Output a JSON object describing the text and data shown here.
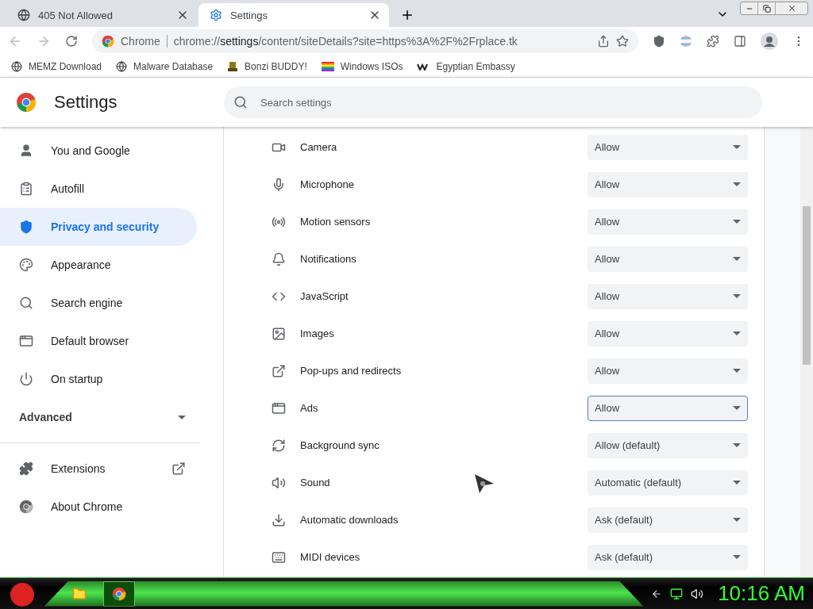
{
  "tabs": [
    {
      "title": "405 Not Allowed",
      "selected": false
    },
    {
      "title": "Settings",
      "selected": true
    }
  ],
  "toolbar": {
    "site_label": "Chrome",
    "url": "chrome://**settings**/content/siteDetails?site=https%3A%2F%2Frplace.tk"
  },
  "bookmarks": [
    {
      "label": "MEMZ Download"
    },
    {
      "label": "Malware Database"
    },
    {
      "label": "Bonzi BUDDY!"
    },
    {
      "label": "Windows ISOs"
    },
    {
      "label": "Egyptian Embassy"
    }
  ],
  "header": {
    "title": "Settings",
    "search_placeholder": "Search settings"
  },
  "sidebar": {
    "items": [
      {
        "label": "You and Google",
        "selected": false
      },
      {
        "label": "Autofill",
        "selected": false
      },
      {
        "label": "Privacy and security",
        "selected": true
      },
      {
        "label": "Appearance",
        "selected": false
      },
      {
        "label": "Search engine",
        "selected": false
      },
      {
        "label": "Default browser",
        "selected": false
      },
      {
        "label": "On startup",
        "selected": false
      }
    ],
    "advanced": {
      "label": "Advanced",
      "expanded": false
    },
    "links": [
      {
        "label": "Extensions"
      },
      {
        "label": "About Chrome"
      }
    ]
  },
  "permissions": [
    {
      "label": "Camera",
      "value": "Allow",
      "focused": false
    },
    {
      "label": "Microphone",
      "value": "Allow",
      "focused": false
    },
    {
      "label": "Motion sensors",
      "value": "Allow",
      "focused": false
    },
    {
      "label": "Notifications",
      "value": "Allow",
      "focused": false
    },
    {
      "label": "JavaScript",
      "value": "Allow",
      "focused": false
    },
    {
      "label": "Images",
      "value": "Allow",
      "focused": false
    },
    {
      "label": "Pop-ups and redirects",
      "value": "Allow",
      "focused": false
    },
    {
      "label": "Ads",
      "value": "Allow",
      "focused": true
    },
    {
      "label": "Background sync",
      "value": "Allow (default)",
      "focused": false
    },
    {
      "label": "Sound",
      "value": "Automatic (default)",
      "focused": false
    },
    {
      "label": "Automatic downloads",
      "value": "Ask (default)",
      "focused": false
    },
    {
      "label": "MIDI devices",
      "value": "Ask (default)",
      "focused": false
    }
  ],
  "taskbar": {
    "apps": [
      {
        "selected": false
      },
      {
        "selected": true
      }
    ],
    "clock": "10:16 AM"
  }
}
